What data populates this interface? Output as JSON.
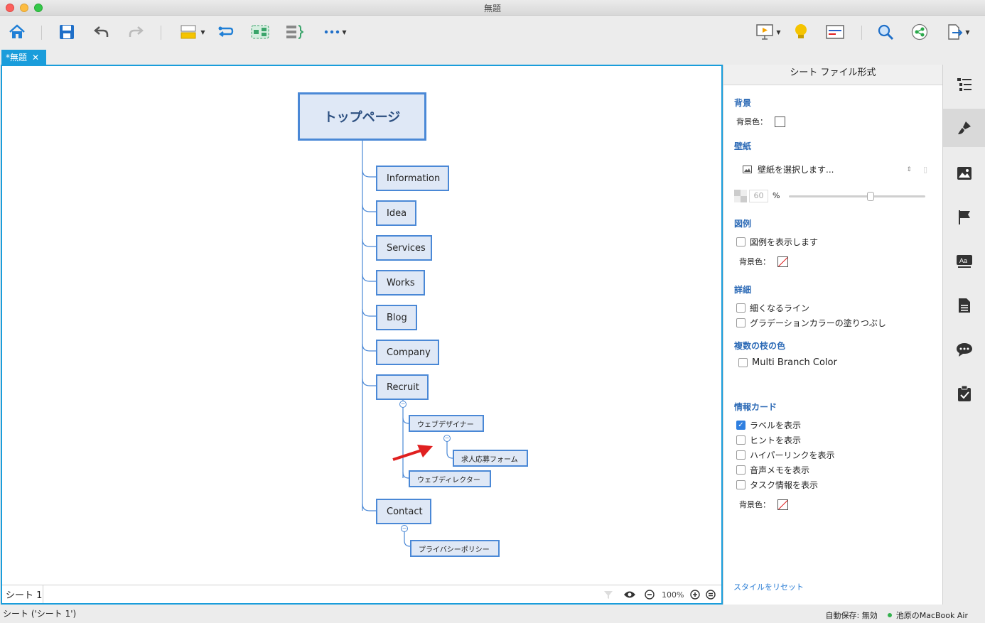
{
  "window": {
    "title": "無題"
  },
  "toolbar": {
    "left": [
      "home-icon",
      "save-icon",
      "undo-icon",
      "redo-icon",
      "topic-icon",
      "relationship-icon",
      "boundary-icon",
      "summary-icon",
      "more-icon"
    ],
    "right": [
      "presentation-icon",
      "lightbulb-icon",
      "outline-icon",
      "search-icon",
      "share-icon",
      "export-icon"
    ]
  },
  "tab": {
    "label": "*無題",
    "close": "✕"
  },
  "mindmap": {
    "central": "トップページ",
    "branches": [
      "Information",
      "Idea",
      "Services",
      "Works",
      "Blog",
      "Company",
      "Recruit",
      "Contact"
    ],
    "recruit_children": [
      "ウェブデザイナー",
      "ウェブディレクター"
    ],
    "designer_children": [
      "求人応募フォーム"
    ],
    "contact_children": [
      "プライバシーポリシー"
    ],
    "collapse_symbol": "−"
  },
  "sheetbar": {
    "sheet_tab": "シート 1",
    "zoom": "100%"
  },
  "status": {
    "left": "シート ('シート 1')",
    "autosave": "自動保存: 無効",
    "device": "池原のMacBook Air"
  },
  "panel": {
    "header": "シート ファイル形式",
    "background": {
      "title": "背景",
      "color_label": "背景色："
    },
    "wallpaper": {
      "title": "壁紙",
      "select_label": "壁紙を選択します...",
      "opacity": "60",
      "unit": "%",
      "opacity_fraction": 0.6
    },
    "legend": {
      "title": "図例",
      "show_label": "図例を表示します",
      "color_label": "背景色："
    },
    "details": {
      "title": "詳細",
      "taper": "細くなるライン",
      "gradient": "グラデーションカラーの塗りつぶし"
    },
    "branch_color": {
      "title": "複数の枝の色",
      "multi": "Multi Branch Color"
    },
    "info_card": {
      "title": "情報カード",
      "items": [
        {
          "label": "ラベルを表示",
          "checked": true
        },
        {
          "label": "ヒントを表示",
          "checked": false
        },
        {
          "label": "ハイパーリンクを表示",
          "checked": false
        },
        {
          "label": "音声メモを表示",
          "checked": false
        },
        {
          "label": "タスク情報を表示",
          "checked": false
        }
      ],
      "color_label": "背景色："
    },
    "reset": "スタイルをリセット"
  },
  "sidebar_icons": [
    "outliner-icon",
    "format-brush-icon",
    "image-icon",
    "marker-flag-icon",
    "text-style-icon",
    "notes-icon",
    "comments-icon",
    "task-icon"
  ],
  "colors": {
    "accent": "#1a9ddb",
    "topic_border": "#4a88d6",
    "topic_fill": "#dfe8f6",
    "arrow": "#e02020"
  }
}
